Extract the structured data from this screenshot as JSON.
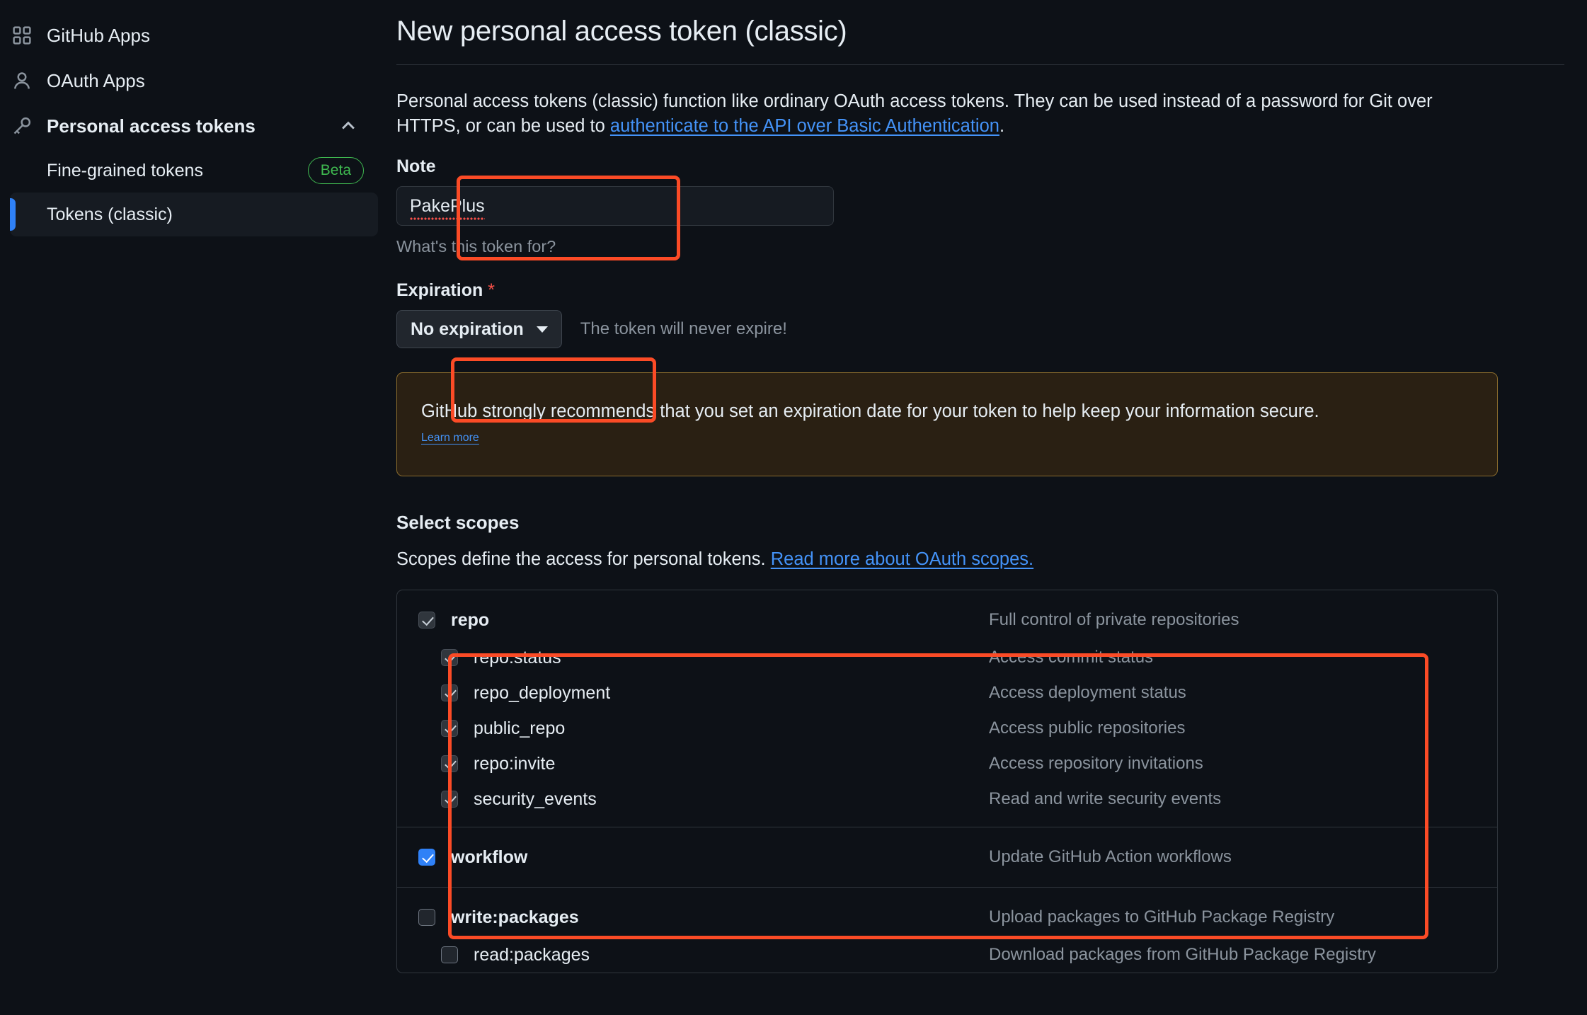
{
  "sidebar": {
    "items": [
      {
        "label": "GitHub Apps",
        "icon": "apps-grid-icon"
      },
      {
        "label": "OAuth Apps",
        "icon": "person-icon"
      },
      {
        "label": "Personal access tokens",
        "icon": "key-icon",
        "chevron": "chevron-up-icon"
      }
    ],
    "sub_items": [
      {
        "label": "Fine-grained tokens",
        "badge": "Beta",
        "active": false
      },
      {
        "label": "Tokens (classic)",
        "badge": "",
        "active": true
      }
    ]
  },
  "main": {
    "title": "New personal access token (classic)",
    "intro_part1": "Personal access tokens (classic) function like ordinary OAuth access tokens. They can be used instead of a password for Git over HTTPS, or can be used to ",
    "intro_link": "authenticate to the API over Basic Authentication",
    "intro_part2": ".",
    "note_label": "Note",
    "note_value": "PakePlus",
    "note_help": "What's this token for?",
    "expiration_label": "Expiration",
    "expiration_required_mark": "*",
    "expiration_value": "No expiration",
    "expiration_note": "The token will never expire!",
    "callout_text": "GitHub strongly recommends that you set an expiration date for your token to help keep your information secure.",
    "callout_link": "Learn more",
    "scopes_heading": "Select scopes",
    "scopes_sub_text": "Scopes define the access for personal tokens. ",
    "scopes_sub_link": "Read more about OAuth scopes."
  },
  "scopes": [
    {
      "name": "repo",
      "desc": "Full control of private repositories",
      "state": "checked-disabled",
      "children": [
        {
          "name": "repo:status",
          "desc": "Access commit status",
          "state": "checked-disabled"
        },
        {
          "name": "repo_deployment",
          "desc": "Access deployment status",
          "state": "checked-disabled"
        },
        {
          "name": "public_repo",
          "desc": "Access public repositories",
          "state": "checked-disabled"
        },
        {
          "name": "repo:invite",
          "desc": "Access repository invitations",
          "state": "checked-disabled"
        },
        {
          "name": "security_events",
          "desc": "Read and write security events",
          "state": "checked-disabled"
        }
      ]
    },
    {
      "name": "workflow",
      "desc": "Update GitHub Action workflows",
      "state": "checked",
      "children": []
    },
    {
      "name": "write:packages",
      "desc": "Upload packages to GitHub Package Registry",
      "state": "unchecked",
      "children": [
        {
          "name": "read:packages",
          "desc": "Download packages from GitHub Package Registry",
          "state": "unchecked"
        }
      ]
    }
  ],
  "colors": {
    "accent_blue": "#2f81f7",
    "link_blue": "#4493f8",
    "beta_green": "#3fb950",
    "annotation_red": "#fb4b26",
    "warning_border": "#8a6c2d",
    "warning_bg": "#2a2013",
    "page_bg": "#0d1117"
  }
}
